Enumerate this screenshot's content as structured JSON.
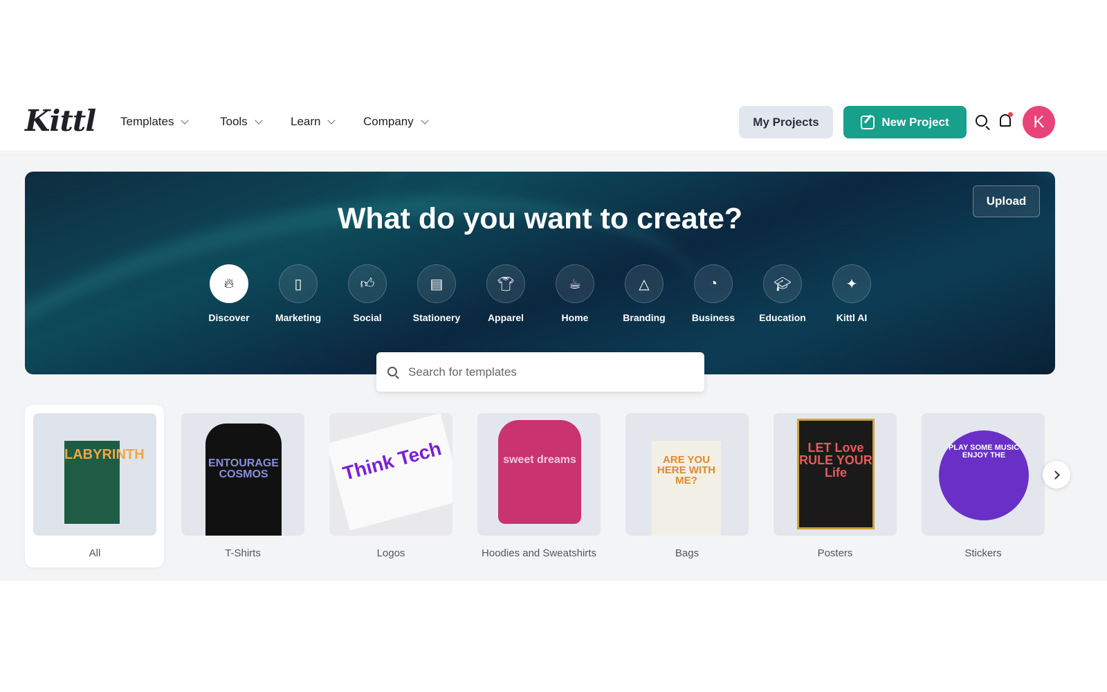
{
  "header": {
    "logo": "Kittl",
    "nav": [
      {
        "label": "Templates"
      },
      {
        "label": "Tools"
      },
      {
        "label": "Learn"
      },
      {
        "label": "Company"
      }
    ],
    "my_projects": "My Projects",
    "new_project": "New Project",
    "avatar_initial": "K",
    "accent": "#17a08c",
    "avatar_color": "#e8447a"
  },
  "hero": {
    "title": "What do you want to create?",
    "upload": "Upload",
    "categories": [
      {
        "label": "Discover",
        "icon": "flame-icon",
        "glyph": "🔥︎"
      },
      {
        "label": "Marketing",
        "icon": "flyer-icon",
        "glyph": "▯"
      },
      {
        "label": "Social",
        "icon": "thumbs-up-icon",
        "glyph": "👍︎"
      },
      {
        "label": "Stationery",
        "icon": "notebook-icon",
        "glyph": "▤"
      },
      {
        "label": "Apparel",
        "icon": "tshirt-icon",
        "glyph": "👕︎"
      },
      {
        "label": "Home",
        "icon": "mug-icon",
        "glyph": "☕︎"
      },
      {
        "label": "Branding",
        "icon": "shapes-icon",
        "glyph": "△"
      },
      {
        "label": "Business",
        "icon": "pie-chart-icon",
        "glyph": "◔"
      },
      {
        "label": "Education",
        "icon": "graduation-cap-icon",
        "glyph": "🎓︎"
      },
      {
        "label": "Kittl AI",
        "icon": "sparkle-icon",
        "glyph": "✦"
      }
    ],
    "search_placeholder": "Search for templates"
  },
  "products": [
    {
      "label": "All",
      "art": "LABYRINTH"
    },
    {
      "label": "T-Shirts",
      "art": "ENTOURAGE COSMOS"
    },
    {
      "label": "Logos",
      "art": "Think Tech"
    },
    {
      "label": "Hoodies and Sweatshirts",
      "art": "sweet dreams"
    },
    {
      "label": "Bags",
      "art": "ARE YOU HERE WITH ME?"
    },
    {
      "label": "Posters",
      "art": "LET Love RULE YOUR Life"
    },
    {
      "label": "Stickers",
      "art": "PLAY SOME MUSIC ENJOY THE"
    }
  ]
}
